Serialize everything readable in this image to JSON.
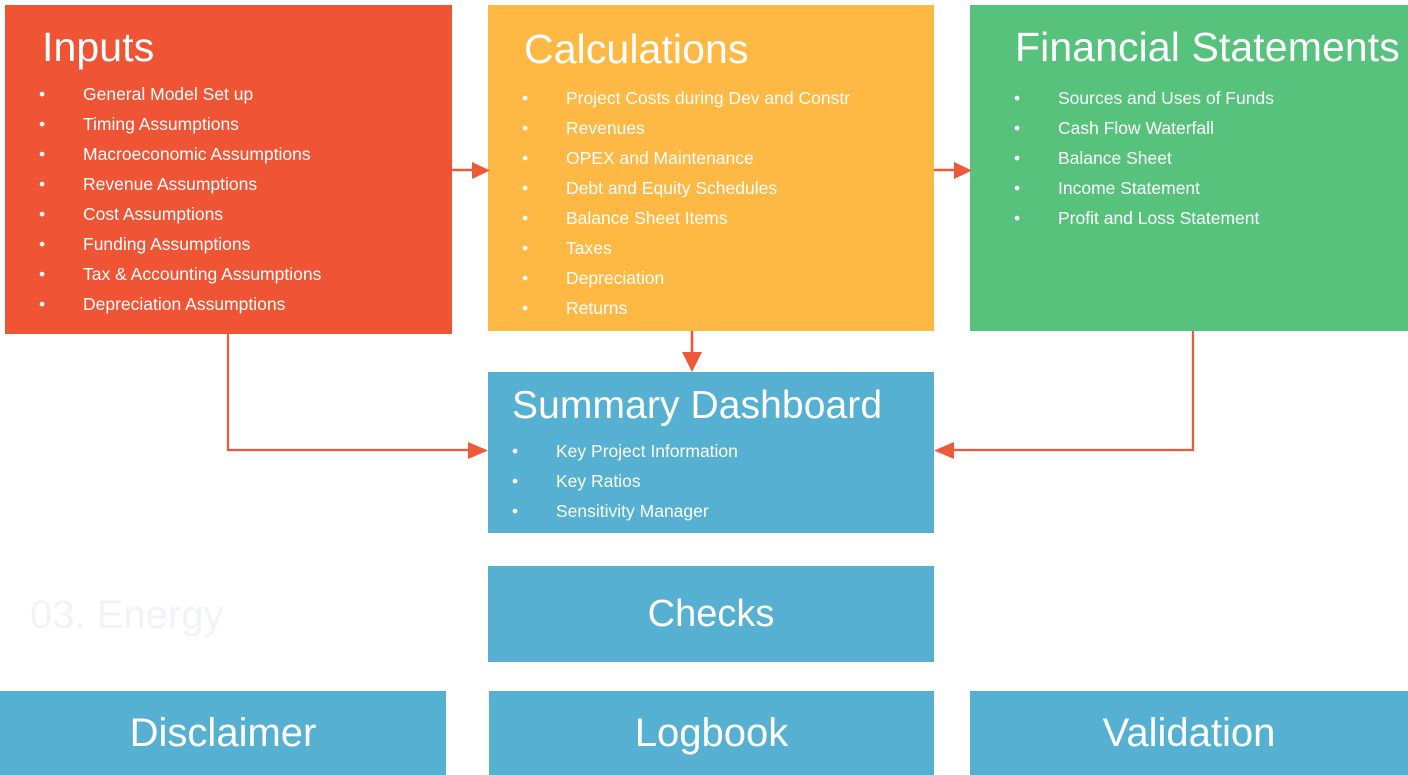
{
  "diagram": {
    "title_watermark": "03. Energy",
    "accent_colors": {
      "inputs": "#EF5435",
      "calculations": "#FDB944",
      "financial_statements": "#56C27C",
      "blue": "#55B0D2",
      "arrow": "#ED5A39",
      "watermark_text": "#F1F3F9"
    },
    "bullet_glyph": "•"
  },
  "boxes": {
    "inputs": {
      "title": "Inputs",
      "items": [
        "General Model Set up",
        "Timing Assumptions",
        "Macroeconomic Assumptions",
        "Revenue Assumptions",
        "Cost Assumptions",
        "Funding Assumptions",
        "Tax & Accounting Assumptions",
        "Depreciation Assumptions"
      ]
    },
    "calculations": {
      "title": "Calculations",
      "items": [
        "Project Costs during Dev and Constr",
        "Revenues",
        "OPEX and Maintenance",
        "Debt and Equity Schedules",
        "Balance Sheet Items",
        "Taxes",
        "Depreciation",
        "Returns"
      ]
    },
    "financial_statements": {
      "title": "Financial Statements",
      "items": [
        "Sources and Uses of Funds",
        "Cash Flow Waterfall",
        "Balance Sheet",
        "Income Statement",
        "Profit and Loss Statement"
      ]
    },
    "summary_dashboard": {
      "title": "Summary Dashboard",
      "items": [
        "Key Project Information",
        "Key Ratios",
        "Sensitivity Manager"
      ]
    },
    "checks": {
      "title": "Checks"
    },
    "disclaimer": {
      "title": "Disclaimer"
    },
    "logbook": {
      "title": "Logbook"
    },
    "validation": {
      "title": "Validation"
    }
  },
  "connections": [
    {
      "from": "inputs",
      "to": "calculations",
      "style": "straight-right"
    },
    {
      "from": "calculations",
      "to": "financial_statements",
      "style": "straight-right"
    },
    {
      "from": "calculations",
      "to": "summary_dashboard",
      "style": "straight-down"
    },
    {
      "from": "inputs",
      "to": "summary_dashboard",
      "style": "elbow-down-right"
    },
    {
      "from": "financial_statements",
      "to": "summary_dashboard",
      "style": "elbow-down-left"
    }
  ]
}
